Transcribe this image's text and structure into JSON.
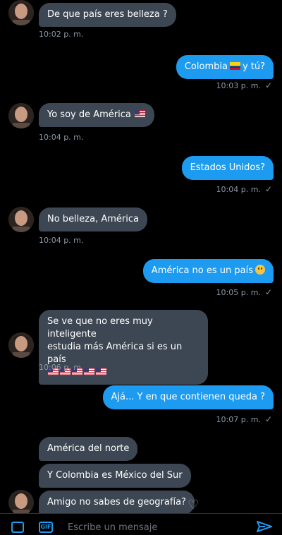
{
  "messages": [
    {
      "dir": "in",
      "text": "De que país eres belleza ?",
      "time": "10:02 p. m."
    },
    {
      "dir": "out",
      "text": "Colombia",
      "text_after": "y tú?",
      "flag": "colombia-flag",
      "time": "10:03 p. m."
    },
    {
      "dir": "in",
      "text": "Yo soy de América",
      "flag": "us-flag",
      "time": "10:04 p. m."
    },
    {
      "dir": "out",
      "text": "Estados Unidos?",
      "time": "10:04 p. m."
    },
    {
      "dir": "in",
      "text": "No belleza, América",
      "time": "10:04 p. m."
    },
    {
      "dir": "out",
      "text": "América no es un país",
      "emoji": "worried-face",
      "time": "10:05 p. m."
    },
    {
      "dir": "in",
      "line1": "Se ve que no eres muy inteligente",
      "line2": "estudia más América si es un país",
      "flags": "us-flag x5",
      "time": "10:06 p. m."
    },
    {
      "dir": "out",
      "text": "Ajá... Y en que contienen queda ?",
      "time": "10:07 p. m."
    },
    {
      "dir": "in",
      "text": "América del norte"
    },
    {
      "dir": "in",
      "text": "Y Colombia es México del Sur"
    },
    {
      "dir": "in",
      "text": "Amigo no sabes de geografía?"
    }
  ],
  "composer": {
    "placeholder": "Escribe un mensaje",
    "image_icon": "image-icon",
    "gif_label": "GIF",
    "send_icon": "send-icon"
  },
  "colors": {
    "incoming_bubble": "#3d4753",
    "outgoing_bubble": "#1d9bf0",
    "timestamp": "#8b98a5",
    "background": "#000000"
  }
}
